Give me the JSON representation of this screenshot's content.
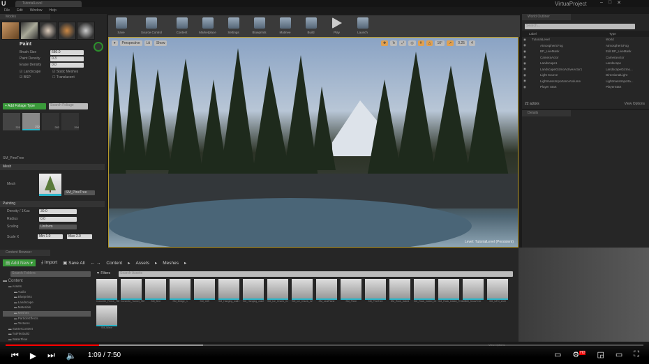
{
  "window": {
    "title": "VirtuaProject",
    "tab": "TutorialLevel",
    "menu": [
      "File",
      "Edit",
      "Window",
      "Help"
    ]
  },
  "modes": {
    "title": "Modes",
    "section": "Paint",
    "fields": [
      {
        "label": "Brush Size",
        "value": "680.0"
      },
      {
        "label": "Paint Density",
        "value": "0.3"
      },
      {
        "label": "Erase Density",
        "value": "0.0"
      }
    ],
    "checks": [
      {
        "label": "Landscape",
        "checked": true
      },
      {
        "label": "Static Meshes",
        "checked": true
      },
      {
        "label": "BSP",
        "checked": true
      },
      {
        "label": "Translucent",
        "checked": false
      }
    ],
    "add_foliage": "+ Add Foliage Type",
    "search_placeholder": "Search Foliage",
    "foliage_counts": [
      "320",
      "272",
      "283",
      "294"
    ],
    "selected_foliage": "SM_PineTree",
    "mesh_section": "Mesh",
    "mesh_label": "Mesh",
    "mesh_value": "SM_PineTree",
    "painting_section": "Painting",
    "painting": [
      {
        "label": "Density / 1Kuu",
        "value": "30.0"
      },
      {
        "label": "Radius",
        "value": "0.0"
      },
      {
        "label": "Scaling",
        "value": "Uniform"
      }
    ],
    "scale_label": "Scale X",
    "scale_min": "Min 1.0",
    "scale_max": "Max 2.0"
  },
  "toolbar": [
    "Save",
    "Source Control",
    "Content",
    "Marketplace",
    "Settings",
    "Blueprints",
    "Matinee",
    "Build",
    "Play",
    "Launch"
  ],
  "viewport": {
    "buttons": [
      "Perspective",
      "Lit",
      "Show"
    ],
    "snap_angle": "10°",
    "camera_speed": "0.25",
    "grid": "4",
    "level_label": "Level:",
    "level_name": "TutorialLevel (Persistent)"
  },
  "outliner": {
    "title": "World Outliner",
    "search_placeholder": "Search...",
    "col_label": "Label",
    "col_type": "Type",
    "rows": [
      {
        "label": "TutorialLevel",
        "type": "World"
      },
      {
        "label": "AtmosphericFog",
        "type": "AtmosphericFog"
      },
      {
        "label": "BP_LiveMask",
        "type": "Edit BP_LiveMask"
      },
      {
        "label": "CameraActor",
        "type": "CameraActor"
      },
      {
        "label": "Landscape1",
        "type": "Landscape"
      },
      {
        "label": "LandscapeGizmoActiveActor1",
        "type": "LandscapeGizmo..."
      },
      {
        "label": "Light Source",
        "type": "DirectionalLight"
      },
      {
        "label": "LightmassImportanceVolume",
        "type": "LightmassImporta..."
      },
      {
        "label": "Player Start",
        "type": "PlayerStart"
      }
    ],
    "count": "22 actors",
    "view_options": "View Options"
  },
  "details": {
    "title": "Details"
  },
  "content": {
    "title": "Content Browser",
    "add_new": "Add New",
    "import": "Import",
    "save_all": "Save All",
    "path": [
      "Content",
      "Assets",
      "Meshes"
    ],
    "filters": "Filters",
    "search_folders": "Search Folders",
    "search_assets": "Search Assets",
    "tree": [
      {
        "label": "Content",
        "level": 0
      },
      {
        "label": "Assets",
        "level": 1
      },
      {
        "label": "Audio",
        "level": 2
      },
      {
        "label": "Blueprints",
        "level": 2
      },
      {
        "label": "Landscape",
        "level": 2
      },
      {
        "label": "Materials",
        "level": 2
      },
      {
        "label": "Meshes",
        "level": 2,
        "selected": true
      },
      {
        "label": "ParticleEffects",
        "level": 2
      },
      {
        "label": "Textures",
        "level": 2
      },
      {
        "label": "StarterContent",
        "level": 1
      },
      {
        "label": "TutFlexbuild",
        "level": 1
      },
      {
        "label": "WaterFlow",
        "level": 1
      }
    ],
    "assets": [
      "Concrete_Fence_Tile",
      "Concrete_Tunnel_Tile",
      "SM_Bed",
      "SM_Bridge_n",
      "SM_Cliff",
      "SM_Hanging_wall1",
      "SM_Hanging_wall2",
      "SM_Ice_Chunk_01",
      "SM_Ice_Chunk_02",
      "SM_LeafPlane",
      "SM_Plant",
      "SM_PineTree",
      "SM_Rock_Dated",
      "SM_Rock_Dated_01",
      "SM_Rock_Dated_Frosted",
      "SM_SnowTree",
      "SM_UFO_shell",
      "SM_Wave"
    ],
    "view_options": "View Options"
  },
  "player": {
    "current": "1:09",
    "duration": "7:50",
    "separator": " / ",
    "progress": 0.147,
    "buffered": 0.31,
    "hd": "HD"
  },
  "colors": {
    "accent": "#3aa03a",
    "progress": "#ff0000",
    "selection": "#2bb5c9"
  }
}
